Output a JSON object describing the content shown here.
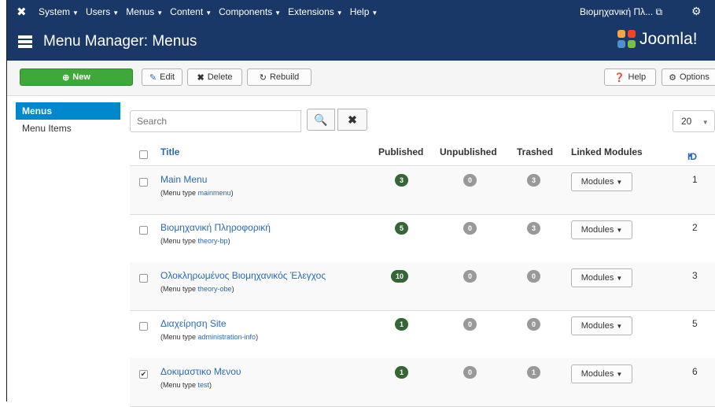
{
  "topnav": {
    "items": [
      "System",
      "Users",
      "Menus",
      "Content",
      "Components",
      "Extensions",
      "Help"
    ],
    "site_name": "Βιομηχανική Πλ..."
  },
  "header": {
    "title": "Menu Manager: Menus",
    "brand": "Joomla!"
  },
  "toolbar": {
    "new": "New",
    "edit": "Edit",
    "delete": "Delete",
    "rebuild": "Rebuild",
    "help": "Help",
    "options": "Options"
  },
  "sidebar": {
    "items": [
      "Menus",
      "Menu Items"
    ],
    "active": "Menus"
  },
  "filter": {
    "search_placeholder": "Search",
    "limit": "20"
  },
  "table": {
    "headers": {
      "title": "Title",
      "published": "Published",
      "unpublished": "Unpublished",
      "trashed": "Trashed",
      "linked_modules": "Linked Modules",
      "id": "ID"
    },
    "type_prefix": "(Menu type ",
    "type_suffix": ")",
    "modules_label": "Modules",
    "rows": [
      {
        "title": "Main Menu",
        "menutype": "mainmenu",
        "published": "3",
        "unpublished": "0",
        "trashed": "3",
        "id": "1",
        "checked": false
      },
      {
        "title": "Βιομηχανική Πληροφορική",
        "menutype": "theory-bp",
        "published": "5",
        "unpublished": "0",
        "trashed": "3",
        "id": "2",
        "checked": false
      },
      {
        "title": "Ολοκληρωμένος Βιομηχανικός Έλεγχος",
        "menutype": "theory-obe",
        "published": "10",
        "unpublished": "0",
        "trashed": "0",
        "id": "3",
        "checked": false
      },
      {
        "title": "Διαχείρηση Site",
        "menutype": "administration-info",
        "published": "1",
        "unpublished": "0",
        "trashed": "0",
        "id": "5",
        "checked": false
      },
      {
        "title": "Δοκιμαστικο Μενου",
        "menutype": "test",
        "published": "1",
        "unpublished": "0",
        "trashed": "1",
        "id": "6",
        "checked": true
      }
    ]
  },
  "colors": {
    "header_bg": "#1a3867",
    "new_button": "#3fa83b",
    "active_sidebar": "#0088cc",
    "link": "#2a69b8",
    "published_badge": "#356635",
    "empty_badge": "#999999"
  }
}
